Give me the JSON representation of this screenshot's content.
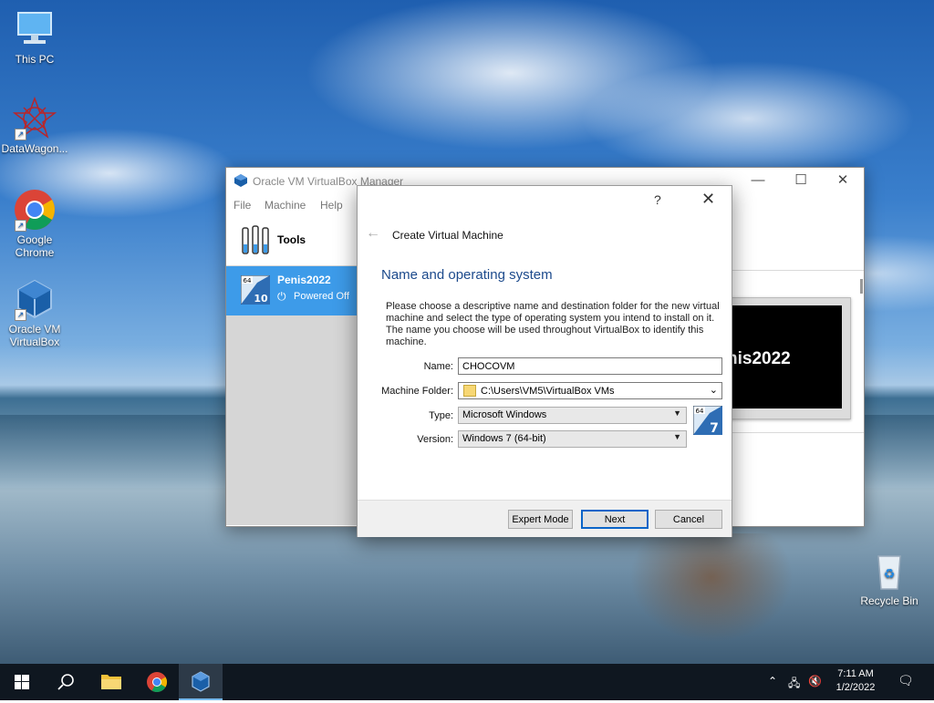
{
  "desktop": {
    "icons": [
      {
        "label": "This PC"
      },
      {
        "label": "DataWagon..."
      },
      {
        "label": "Google Chrome"
      },
      {
        "label": "Oracle VM VirtualBox"
      },
      {
        "label": "Recycle Bin"
      }
    ]
  },
  "vbox_manager": {
    "title": "Oracle VM VirtualBox Manager",
    "menu": [
      "File",
      "Machine",
      "Help"
    ],
    "tools_label": "Tools",
    "vm": {
      "name": "Penis2022",
      "state": "Powered Off",
      "os_badge": "10",
      "arch_badge": "64"
    },
    "preview_text": "nis2022",
    "window_controls": {
      "minimize": "—",
      "maximize": "☐",
      "close": "✕"
    }
  },
  "dialog": {
    "help": "?",
    "close": "✕",
    "back": "←",
    "title": "Create Virtual Machine",
    "heading": "Name and operating system",
    "description": "Please choose a descriptive name and destination folder for the new virtual machine and select the type of operating system you intend to install on it. The name you choose will be used throughout VirtualBox to identify this machine.",
    "fields": {
      "name_label": "Name:",
      "name_value": "CHOCOVM",
      "folder_label": "Machine Folder:",
      "folder_value": "C:\\Users\\VM5\\VirtualBox VMs",
      "type_label": "Type:",
      "type_value": "Microsoft Windows",
      "version_label": "Version:",
      "version_value": "Windows 7 (64-bit)"
    },
    "os_icon": {
      "arch": "64",
      "version": "7"
    },
    "buttons": {
      "expert": "Expert Mode",
      "next": "Next",
      "cancel": "Cancel"
    }
  },
  "taskbar": {
    "clock_time": "7:11 AM",
    "clock_date": "1/2/2022"
  },
  "colors": {
    "accent_blue": "#3d9be9",
    "heading_blue": "#1c4a8c",
    "taskbar": "#0f1720"
  }
}
